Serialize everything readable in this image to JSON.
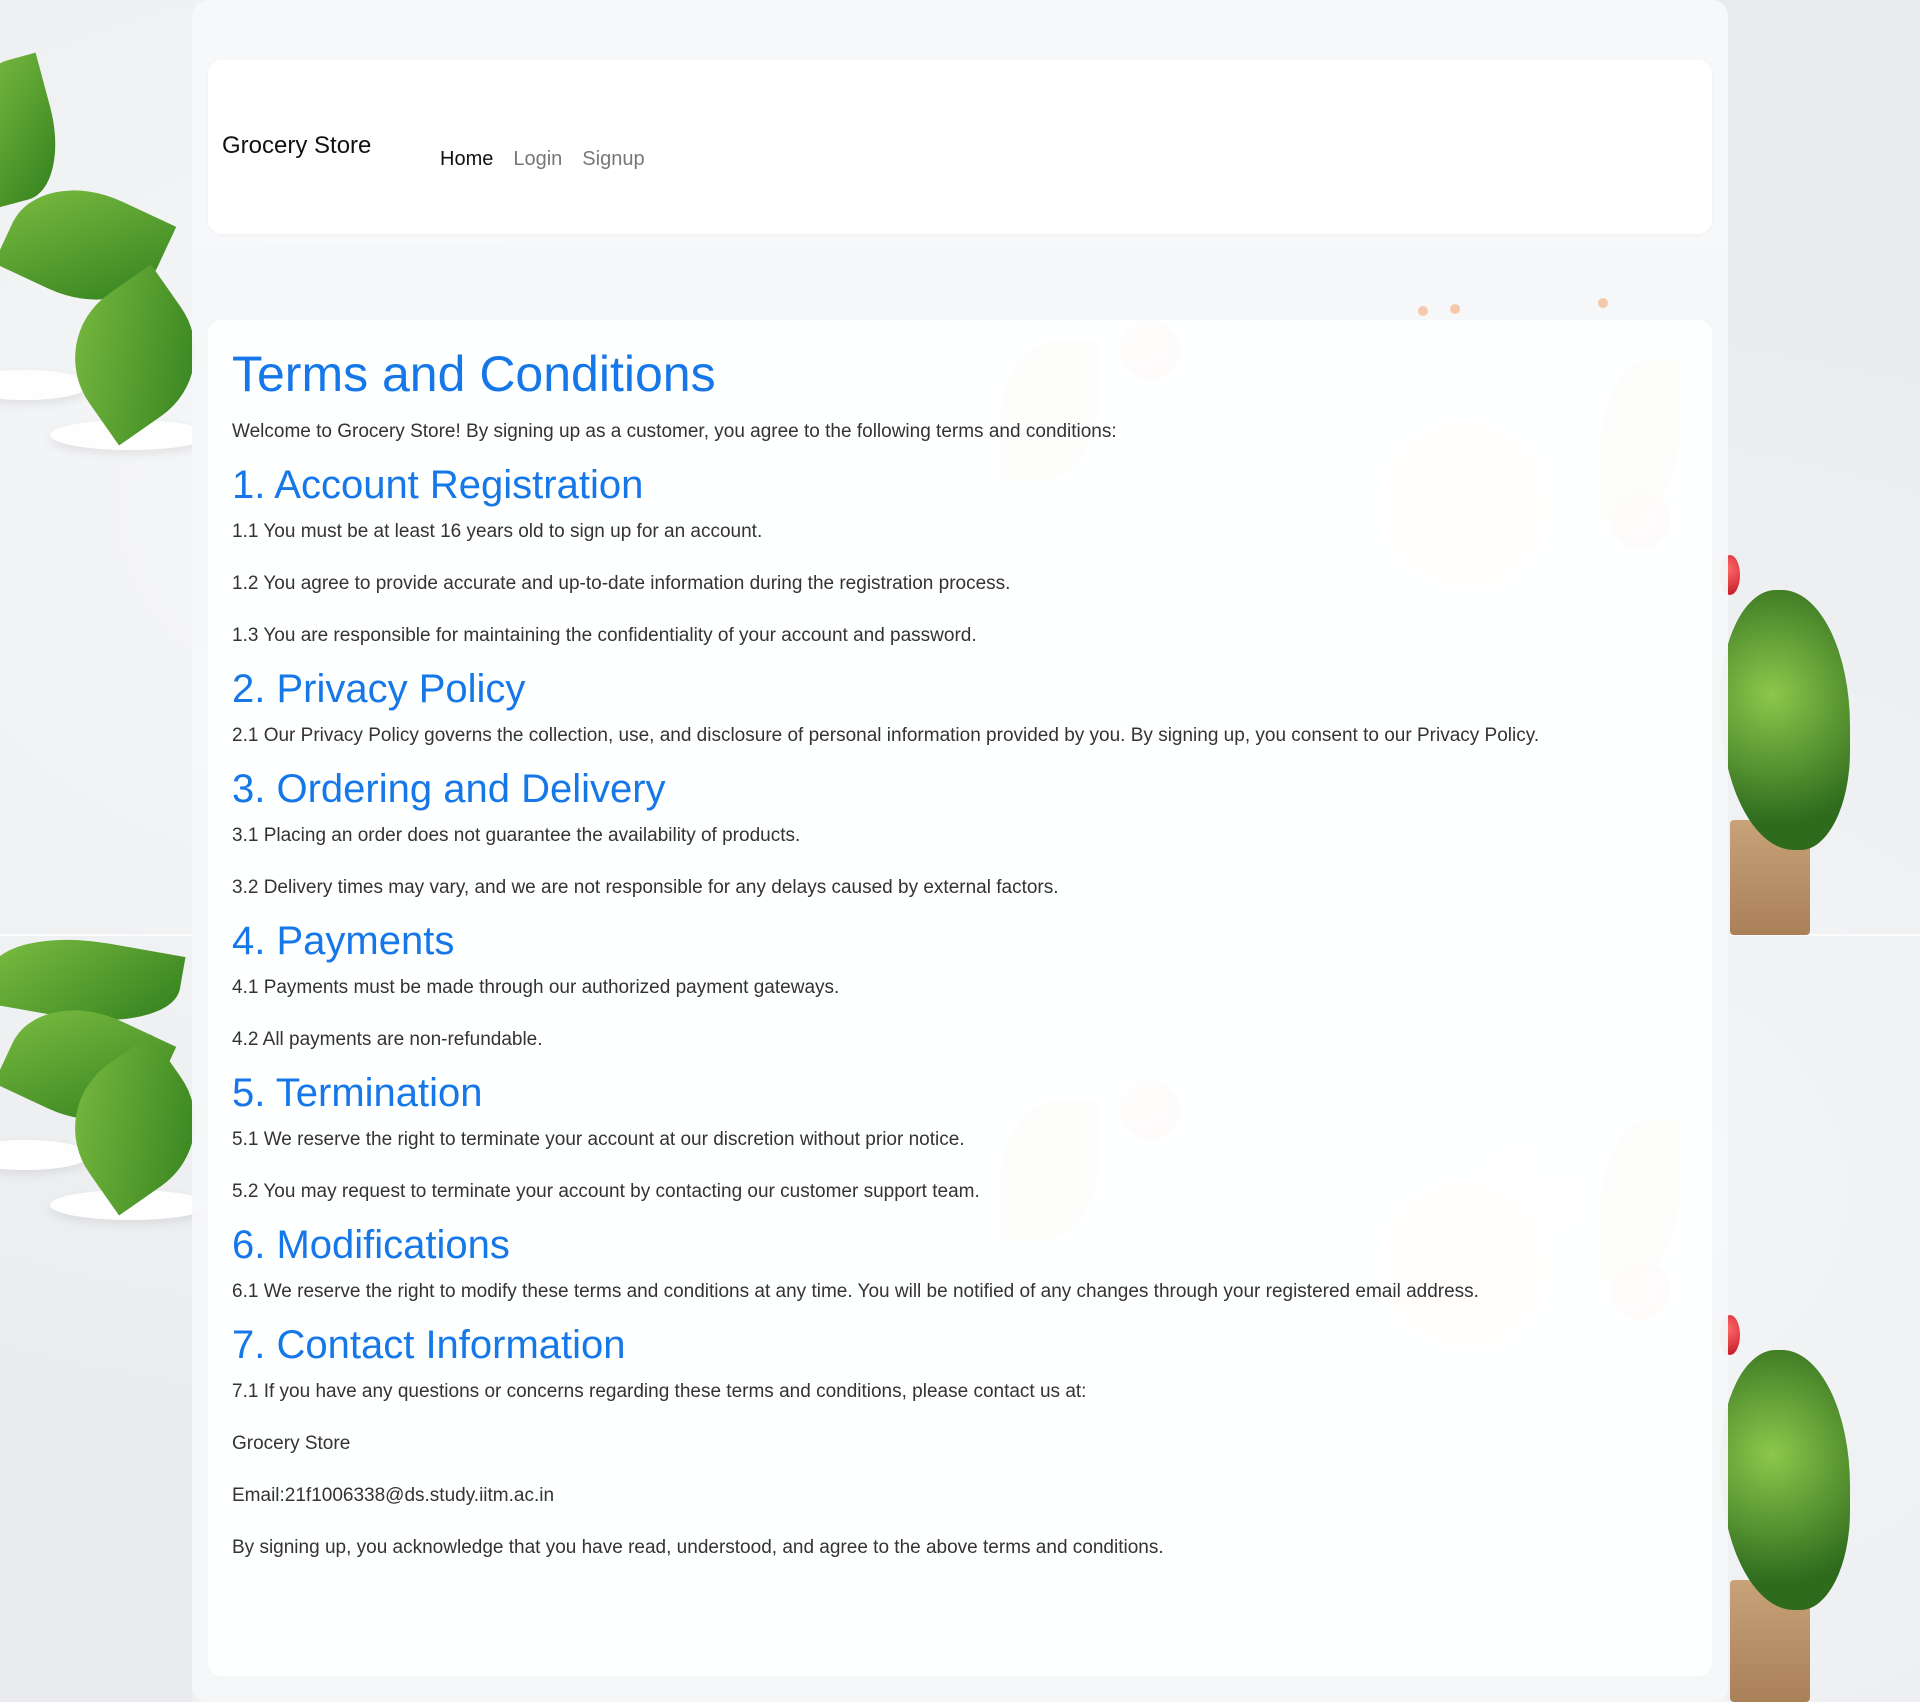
{
  "navbar": {
    "brand": "Grocery Store",
    "links": [
      "Home",
      "Login",
      "Signup"
    ],
    "active": "Home"
  },
  "terms": {
    "title": "Terms and Conditions",
    "intro": "Welcome to Grocery Store! By signing up as a customer, you agree to the following terms and conditions:",
    "sections": [
      {
        "heading": "1. Account Registration",
        "items": [
          "1.1 You must be at least 16 years old to sign up for an account.",
          "1.2 You agree to provide accurate and up-to-date information during the registration process.",
          "1.3 You are responsible for maintaining the confidentiality of your account and password."
        ]
      },
      {
        "heading": "2. Privacy Policy",
        "items": [
          "2.1 Our Privacy Policy governs the collection, use, and disclosure of personal information provided by you. By signing up, you consent to our Privacy Policy."
        ]
      },
      {
        "heading": "3. Ordering and Delivery",
        "items": [
          "3.1 Placing an order does not guarantee the availability of products.",
          "3.2 Delivery times may vary, and we are not responsible for any delays caused by external factors."
        ]
      },
      {
        "heading": "4. Payments",
        "items": [
          "4.1 Payments must be made through our authorized payment gateways.",
          "4.2 All payments are non-refundable."
        ]
      },
      {
        "heading": "5. Termination",
        "items": [
          "5.1 We reserve the right to terminate your account at our discretion without prior notice.",
          "5.2 You may request to terminate your account by contacting our customer support team."
        ]
      },
      {
        "heading": "6. Modifications",
        "items": [
          "6.1 We reserve the right to modify these terms and conditions at any time. You will be notified of any changes through your registered email address."
        ]
      },
      {
        "heading": "7. Contact Information",
        "items": [
          "7.1 If you have any questions or concerns regarding these terms and conditions, please contact us at:",
          "Grocery Store",
          "Email:21f1006338@ds.study.iitm.ac.in",
          "By signing up, you acknowledge that you have read, understood, and agree to the above terms and conditions."
        ]
      }
    ]
  },
  "colors": {
    "heading": "#1677e8",
    "text": "#333333",
    "nav_inactive": "#777777"
  }
}
